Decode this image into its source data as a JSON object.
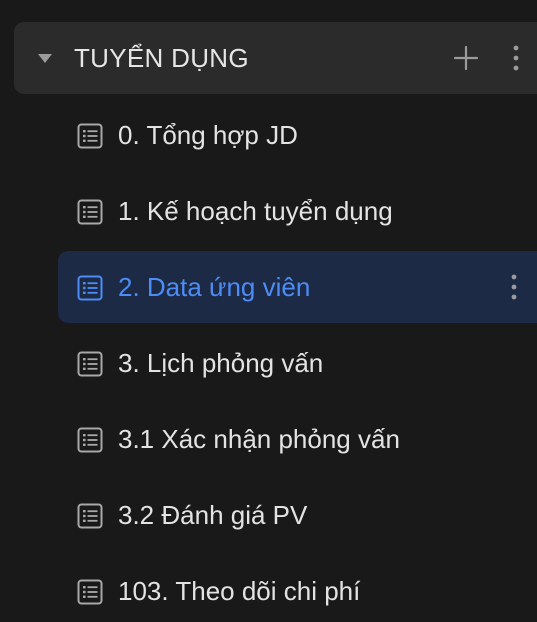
{
  "section": {
    "title": "TUYỂN DỤNG",
    "caret_icon": "caret-down-icon",
    "add_icon": "plus-icon",
    "more_icon": "more-vertical-icon"
  },
  "pages": [
    {
      "label": "0. Tổng hợp JD",
      "icon": "table-page-icon",
      "active": false
    },
    {
      "label": "1. Kế hoạch tuyển dụng",
      "icon": "table-page-icon",
      "active": false
    },
    {
      "label": "2. Data ứng viên",
      "icon": "table-page-icon",
      "active": true
    },
    {
      "label": "3. Lịch phỏng vấn",
      "icon": "table-page-icon",
      "active": false
    },
    {
      "label": "3.1 Xác nhận phỏng vấn",
      "icon": "table-page-icon",
      "active": false
    },
    {
      "label": "3.2 Đánh giá PV",
      "icon": "table-page-icon",
      "active": false
    },
    {
      "label": "103. Theo dõi chi phí",
      "icon": "table-page-icon",
      "active": false
    }
  ],
  "colors": {
    "background": "#191919",
    "header_bg": "#2b2b2b",
    "active_bg": "#1c2a45",
    "active_text": "#4d8cf5",
    "text": "#e3e3e3",
    "icon": "#a8a8a8"
  }
}
